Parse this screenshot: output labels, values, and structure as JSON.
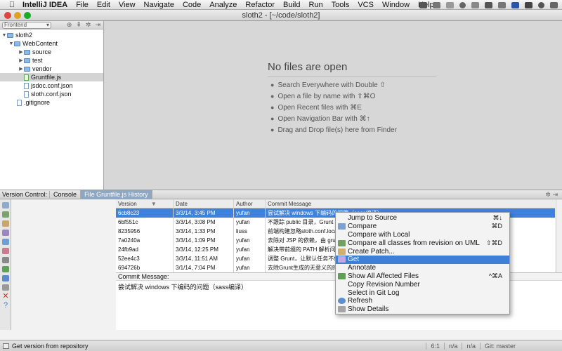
{
  "menubar": {
    "apple": "",
    "app": "IntelliJ IDEA",
    "menus": [
      "File",
      "Edit",
      "View",
      "Navigate",
      "Code",
      "Analyze",
      "Refactor",
      "Build",
      "Run",
      "Tools",
      "VCS",
      "Window",
      "Help"
    ]
  },
  "window": {
    "title": "sloth2 - [~/code/sloth2]"
  },
  "project": {
    "view_selector": "Frontend",
    "tree": [
      {
        "label": "sloth2",
        "level": 0,
        "kind": "folder"
      },
      {
        "label": "WebContent",
        "level": 1,
        "kind": "folder"
      },
      {
        "label": "source",
        "level": 2,
        "kind": "folder"
      },
      {
        "label": "test",
        "level": 2,
        "kind": "folder"
      },
      {
        "label": "vendor",
        "level": 2,
        "kind": "folder"
      },
      {
        "label": "Gruntfile.js",
        "level": 2,
        "kind": "js"
      },
      {
        "label": "jsdoc.conf.json",
        "level": 2,
        "kind": "file"
      },
      {
        "label": "sloth.conf.json",
        "level": 2,
        "kind": "file"
      },
      {
        "label": ".gitignore",
        "level": 1,
        "kind": "file"
      }
    ]
  },
  "editor": {
    "empty_title": "No files are open",
    "hints": [
      "Search Everywhere with Double ⇧",
      "Open a file by name with ⇧⌘O",
      "Open Recent files with ⌘E",
      "Open Navigation Bar with ⌘↑",
      "Drag and Drop file(s) here from Finder"
    ]
  },
  "vc": {
    "label": "Version Control:",
    "tabs": [
      "Console",
      "File Gruntfile.js History"
    ],
    "columns": [
      "Version",
      "Date",
      "Author",
      "Commit Message"
    ],
    "rows": [
      {
        "version": "6cb8c23",
        "date": "3/3/14, 3:45 PM",
        "author": "yufan",
        "message": "尝试解决 windows 下编码的问题（sass编译）"
      },
      {
        "version": "6bf551c",
        "date": "3/3/14, 3:08 PM",
        "author": "yufan",
        "message": "不跟踪 public 目录，Grunt"
      },
      {
        "version": "8235956",
        "date": "3/3/14, 1:33 PM",
        "author": "liuss",
        "message": "前端构建忽略sloth.conf.loca"
      },
      {
        "version": "7a0240a",
        "date": "3/3/14, 1:09 PM",
        "author": "yufan",
        "message": "去除对 JSP 的依赖，由 grun"
      },
      {
        "version": "24fb9ad",
        "date": "3/3/14, 12:25 PM",
        "author": "yufan",
        "message": "解决带前缀的 PATH 解析问题"
      },
      {
        "version": "52ee4c3",
        "date": "3/3/14, 11:51 AM",
        "author": "yufan",
        "message": "调整 Grunt，让默认任务不使"
      },
      {
        "version": "694726b",
        "date": "3/1/14, 7:04 PM",
        "author": "yufan",
        "message": "去除Grunt生成的无意义的时"
      }
    ],
    "commit_label": "Commit Message:",
    "commit_text": "尝试解决 windows 下编码的问题（sass编译）"
  },
  "context_menu": [
    {
      "label": "Jump to Source",
      "shortcut": "⌘↓",
      "icon": "",
      "highlight": false
    },
    {
      "label": "Compare",
      "shortcut": "⌘D",
      "icon": "compare-icon",
      "highlight": false
    },
    {
      "label": "Compare with Local",
      "shortcut": "",
      "icon": "",
      "highlight": false
    },
    {
      "label": "Compare all classes from revision on UML",
      "shortcut": "⇧⌘D",
      "icon": "uml-icon",
      "highlight": false
    },
    {
      "label": "Create Patch...",
      "shortcut": "",
      "icon": "patch-icon",
      "highlight": false
    },
    {
      "label": "Get",
      "shortcut": "",
      "icon": "get-icon",
      "highlight": true
    },
    {
      "label": "Annotate",
      "shortcut": "",
      "icon": "",
      "highlight": false
    },
    {
      "label": "Show All Affected Files",
      "shortcut": "^⌘A",
      "icon": "affected-files-icon",
      "highlight": false
    },
    {
      "label": "Copy Revision Number",
      "shortcut": "",
      "icon": "",
      "highlight": false
    },
    {
      "label": "Select in Git Log",
      "shortcut": "",
      "icon": "",
      "highlight": false
    },
    {
      "label": "Refresh",
      "shortcut": "",
      "icon": "refresh-icon",
      "highlight": false
    },
    {
      "label": "Show Details",
      "shortcut": "",
      "icon": "details-icon",
      "highlight": false
    }
  ],
  "status": {
    "message": "Get version from repository",
    "position": "6:1",
    "na1": "n/a",
    "na2": "n/a",
    "git": "Git: master"
  }
}
